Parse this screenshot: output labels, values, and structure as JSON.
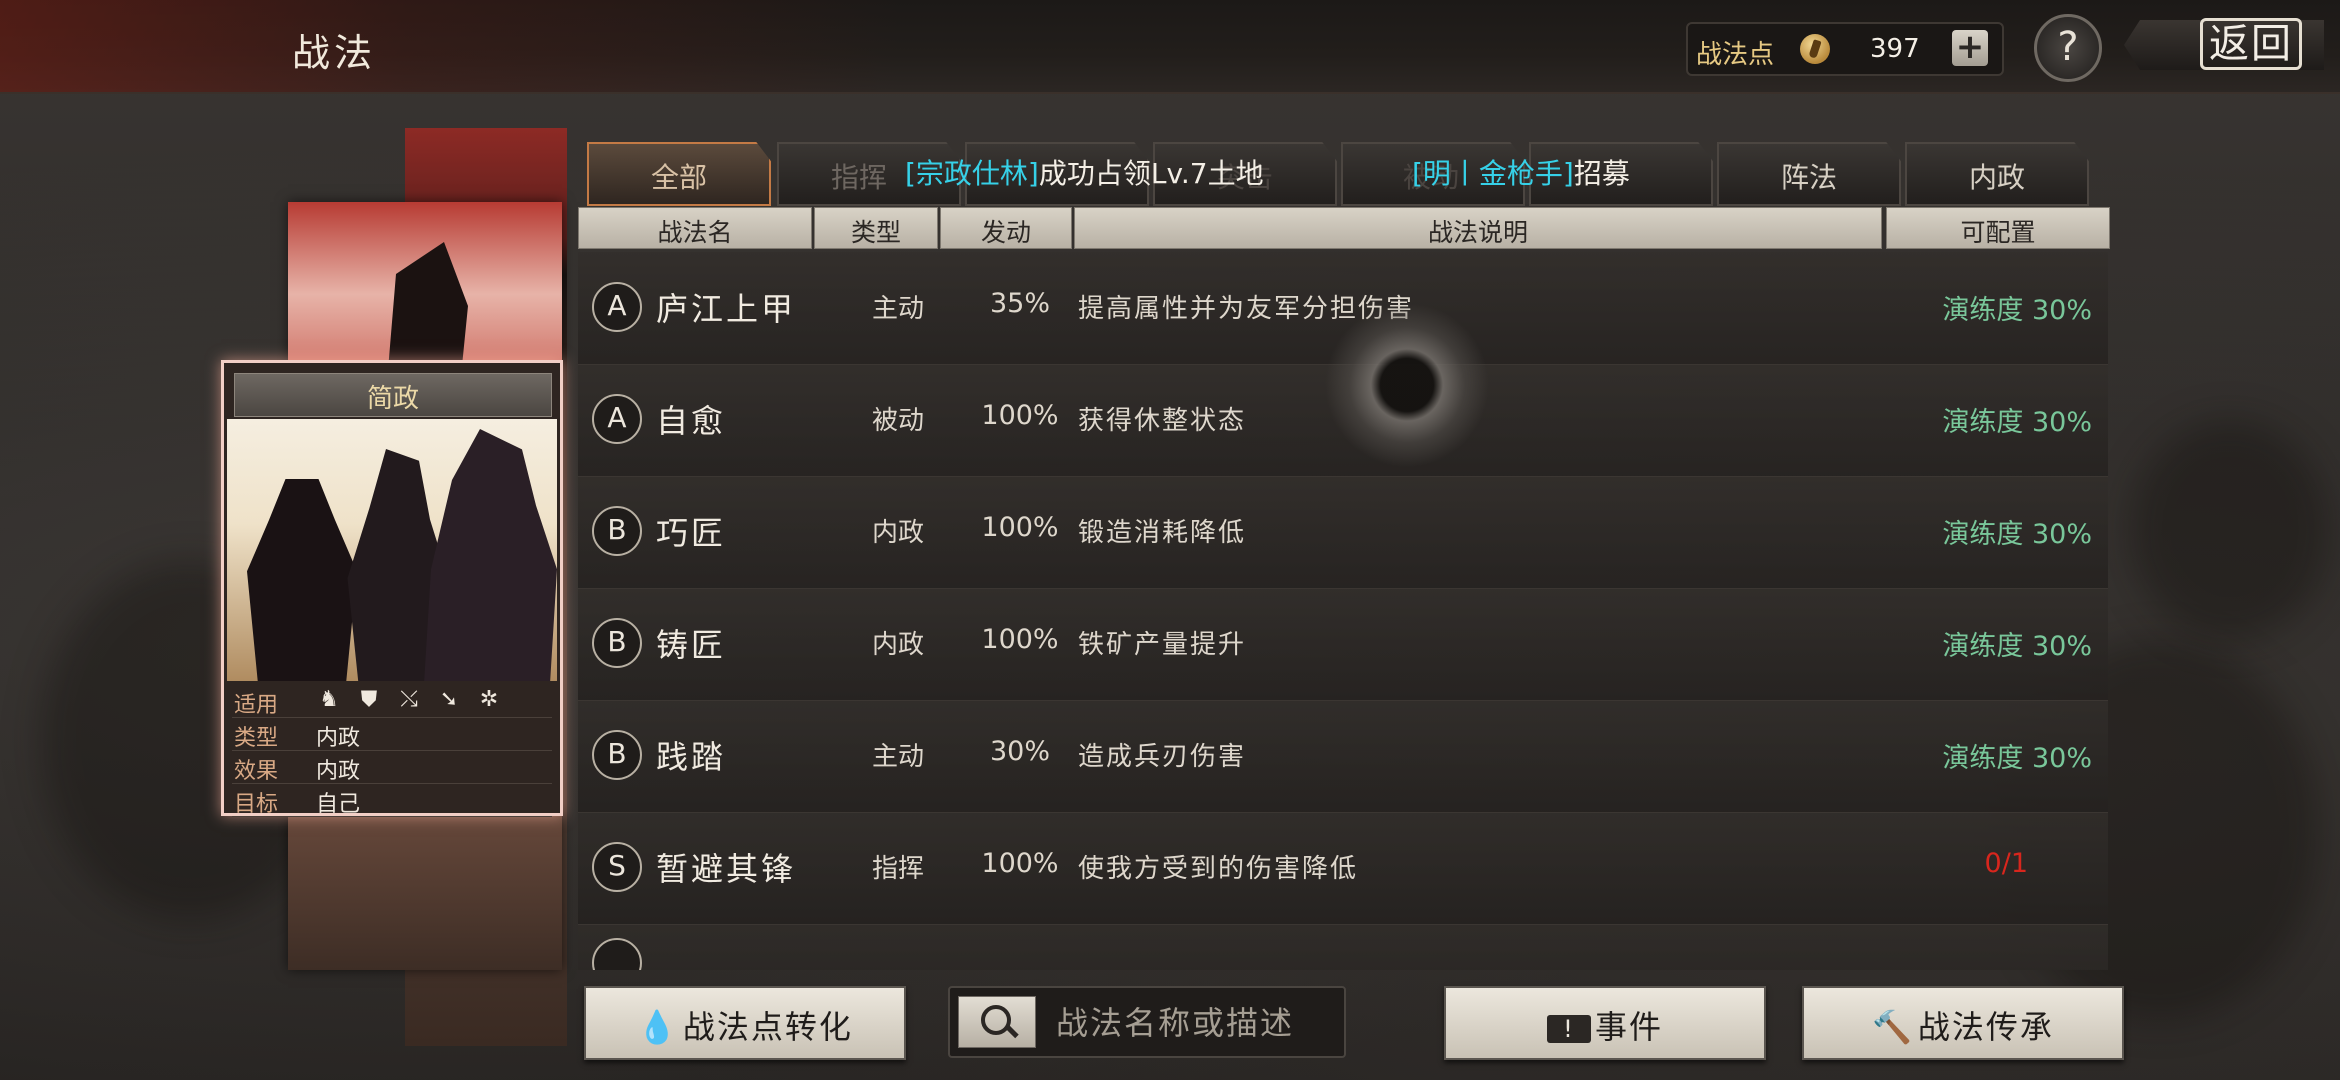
{
  "header": {
    "title": "战法",
    "points_label": "战法点",
    "points_value": "397",
    "plus": "+",
    "help": "?",
    "back": "返回"
  },
  "hero_card": {
    "name": "简政",
    "attrs": [
      {
        "key": "适用",
        "value": ""
      },
      {
        "key": "类型",
        "value": "内政"
      },
      {
        "key": "效果",
        "value": "内政"
      },
      {
        "key": "目标",
        "value": "自己"
      }
    ],
    "unit_icons": [
      "cavalry-icon",
      "shield-icon",
      "bow-icon",
      "spear-icon",
      "wheel-icon"
    ]
  },
  "tabs": [
    {
      "label": "全部",
      "active": true
    },
    {
      "label": "指挥"
    },
    {
      "label": ""
    },
    {
      "label": "突击"
    },
    {
      "label": "被动"
    },
    {
      "label": ""
    },
    {
      "label": "阵法"
    },
    {
      "label": "内政"
    }
  ],
  "notice": {
    "first": {
      "player": "[宗政仕林]",
      "text": "成功占领Lv.7土地"
    },
    "second": {
      "player": "[明丨金枪手]",
      "text": "招募"
    }
  },
  "table": {
    "headers": {
      "name": "战法名",
      "type": "类型",
      "rate": "发动",
      "desc": "战法说明",
      "avail": "可配置"
    },
    "rows": [
      {
        "grade": "A",
        "name": "庐江上甲",
        "type": "主动",
        "rate": "35%",
        "desc": "提高属性并为友军分担伤害",
        "avail": "演练度 30%"
      },
      {
        "grade": "A",
        "name": "自愈",
        "type": "被动",
        "rate": "100%",
        "desc": "获得休整状态",
        "avail": "演练度 30%"
      },
      {
        "grade": "B",
        "name": "巧匠",
        "type": "内政",
        "rate": "100%",
        "desc": "锻造消耗降低",
        "avail": "演练度 30%"
      },
      {
        "grade": "B",
        "name": "铸匠",
        "type": "内政",
        "rate": "100%",
        "desc": "铁矿产量提升",
        "avail": "演练度 30%"
      },
      {
        "grade": "B",
        "name": "践踏",
        "type": "主动",
        "rate": "30%",
        "desc": "造成兵刃伤害",
        "avail": "演练度 30%"
      },
      {
        "grade": "S",
        "name": "暂避其锋",
        "type": "指挥",
        "rate": "100%",
        "desc": "使我方受到的伤害降低",
        "avail": "0/1"
      }
    ]
  },
  "bottom": {
    "convert_label": "战法点转化",
    "search_placeholder": "战法名称或描述",
    "event_label": "事件",
    "inherit_label": "战法传承"
  },
  "colors": {
    "available": "#79c79a",
    "unavailable": "#d8261d",
    "notice_player": "#36d1e8",
    "card_glow": "#f2cfc6"
  }
}
